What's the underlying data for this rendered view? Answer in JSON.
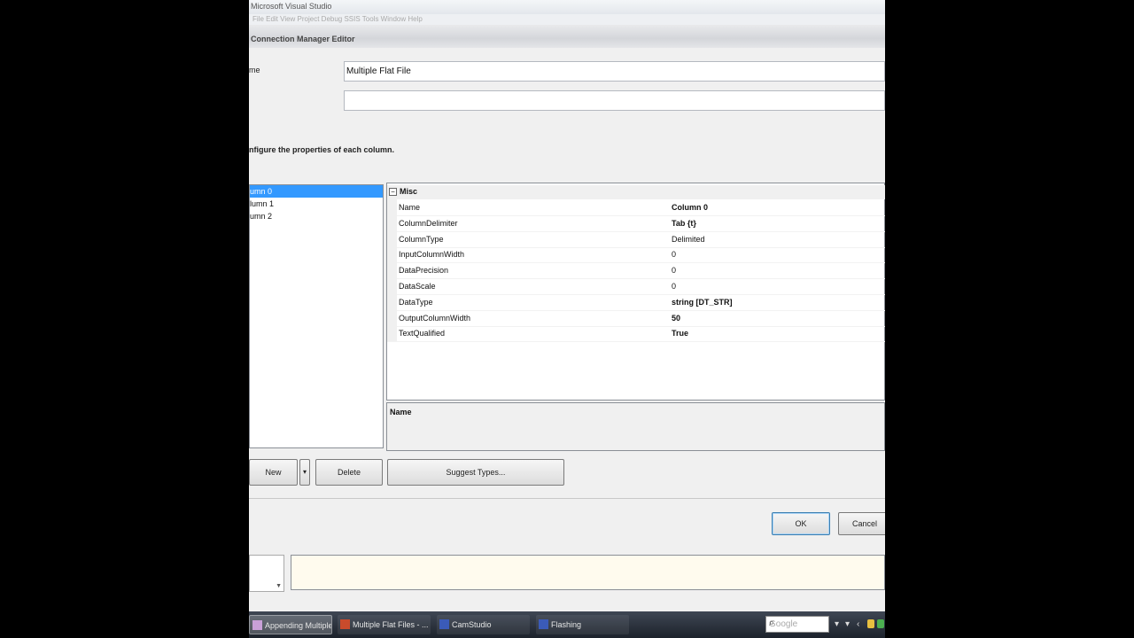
{
  "vs": {
    "title": "Microsoft Visual Studio",
    "menu": "File  Edit  View  Project  Debug  SSIS  Tools  Window  Help"
  },
  "dialog": {
    "title": "Connection Manager Editor",
    "name_label": "me",
    "name_value": "Multiple Flat File",
    "description_value": "",
    "instruction": "nfigure the properties of each column.",
    "columns": [
      "umn 0",
      "lumn 1",
      "umn 2"
    ],
    "category": "Misc",
    "properties": [
      {
        "name": "Name",
        "value": "Column 0",
        "bold": true
      },
      {
        "name": "ColumnDelimiter",
        "value": "Tab {t}",
        "bold": true
      },
      {
        "name": "ColumnType",
        "value": "Delimited",
        "bold": false
      },
      {
        "name": "InputColumnWidth",
        "value": "0",
        "bold": false
      },
      {
        "name": "DataPrecision",
        "value": "0",
        "bold": false
      },
      {
        "name": "DataScale",
        "value": "0",
        "bold": false
      },
      {
        "name": "DataType",
        "value": "string [DT_STR]",
        "bold": true
      },
      {
        "name": "OutputColumnWidth",
        "value": "50",
        "bold": true
      },
      {
        "name": "TextQualified",
        "value": "True",
        "bold": true
      }
    ],
    "description_title": "Name",
    "buttons": {
      "new": "New",
      "new_arrow": "▾",
      "delete": "Delete",
      "suggest": "Suggest Types...",
      "ok": "OK",
      "cancel": "Cancel"
    }
  },
  "taskbar": {
    "items": [
      "Appending Multiple...",
      "Multiple Flat Files - ...",
      "CamStudio",
      "Flashing"
    ],
    "search_placeholder": "Google",
    "search_icon": "magnifier-icon"
  },
  "colors": {
    "selection": "#3399ff",
    "taskbar": "#2a313c"
  }
}
